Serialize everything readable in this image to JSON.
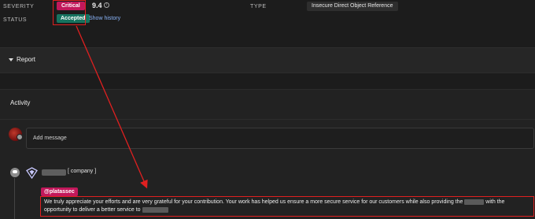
{
  "header": {
    "severity_label": "SEVERITY",
    "severity_badge": "Critical",
    "score": "9.4",
    "status_label": "STATUS",
    "status_badge": "Accepted",
    "show_history": "Show history",
    "type_label": "TYPE",
    "type_value": "Insecure Direct Object Reference"
  },
  "report": {
    "title": "Report"
  },
  "activity": {
    "title": "Activity",
    "add_message_placeholder": "Add message",
    "comment": {
      "company_suffix": "[ company ]",
      "mention": "@platassec",
      "text_part1": "We truly appreciate your efforts and are very grateful for your contribution. Your work has helped us ensure a more secure service for our customers while also providing the ",
      "text_part2": " with the opportunity to deliver a better service to "
    }
  },
  "colors": {
    "critical": "#c2185b",
    "accepted": "#16735f",
    "annotation": "#e02020",
    "link": "#8ab4f8"
  }
}
